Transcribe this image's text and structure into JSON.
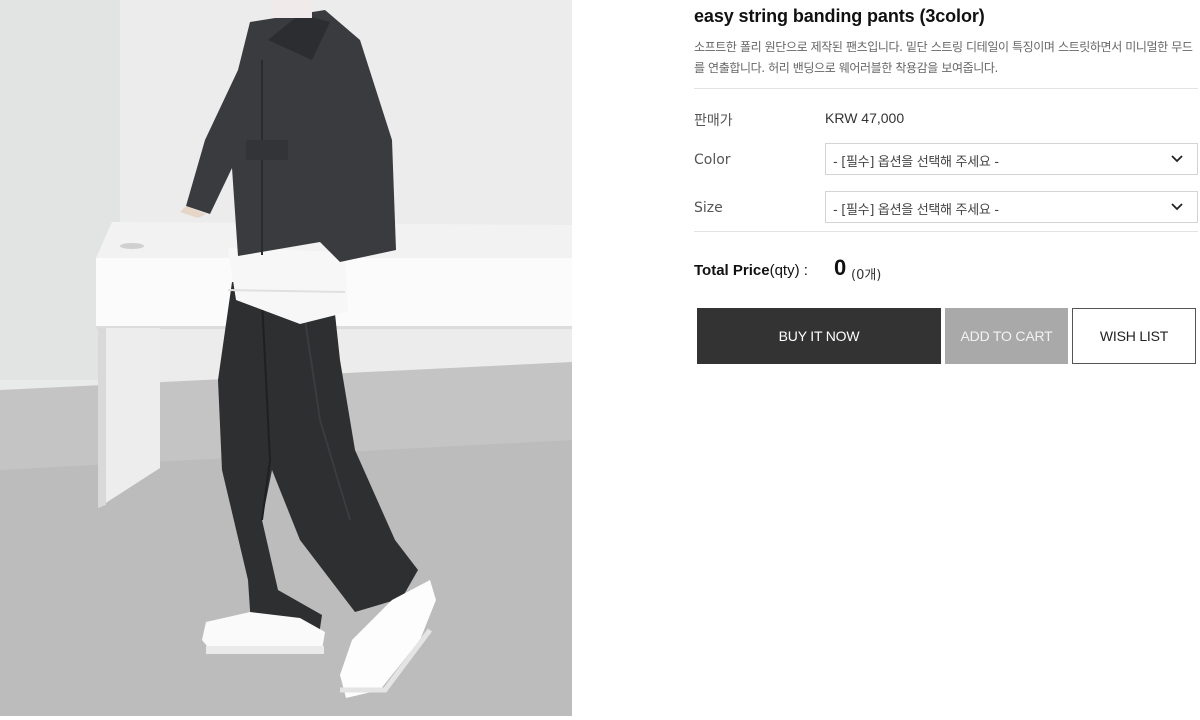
{
  "product": {
    "title": "easy string banding pants (3color)",
    "description": "소프트한 폴리 원단으로 제작된 팬츠입니다. 밑단 스트링 디테일이 특징이며 스트릿하면서 미니멀한 무드를 연출합니다. 허리 밴딩으로 웨어러블한 착용감을 보여줍니다.",
    "image_subject": "model in dark jacket, white t-shirt, charcoal wide pants and white sneakers beside a white desk"
  },
  "price": {
    "label": "판매가",
    "value": "KRW 47,000"
  },
  "options": [
    {
      "label": "Color",
      "selected": "- [필수] 옵션을 선택해 주세요 -",
      "icon": "chevron-down-icon"
    },
    {
      "label": "Size",
      "selected": "- [필수] 옵션을 선택해 주세요 -",
      "icon": "chevron-down-icon"
    }
  ],
  "total": {
    "label_bold": "Total Price",
    "label_suffix": "(qty) :",
    "value": "0",
    "qty": "(0개)"
  },
  "buttons": {
    "buy_now": "BUY IT NOW",
    "add_to_cart": "ADD TO CART",
    "wish_list": "WISH LIST"
  },
  "colors": {
    "buy_bg": "#333333",
    "cart_bg": "#a9a9a9",
    "wish_border": "#555555",
    "image_bg": "#e9eaea"
  }
}
